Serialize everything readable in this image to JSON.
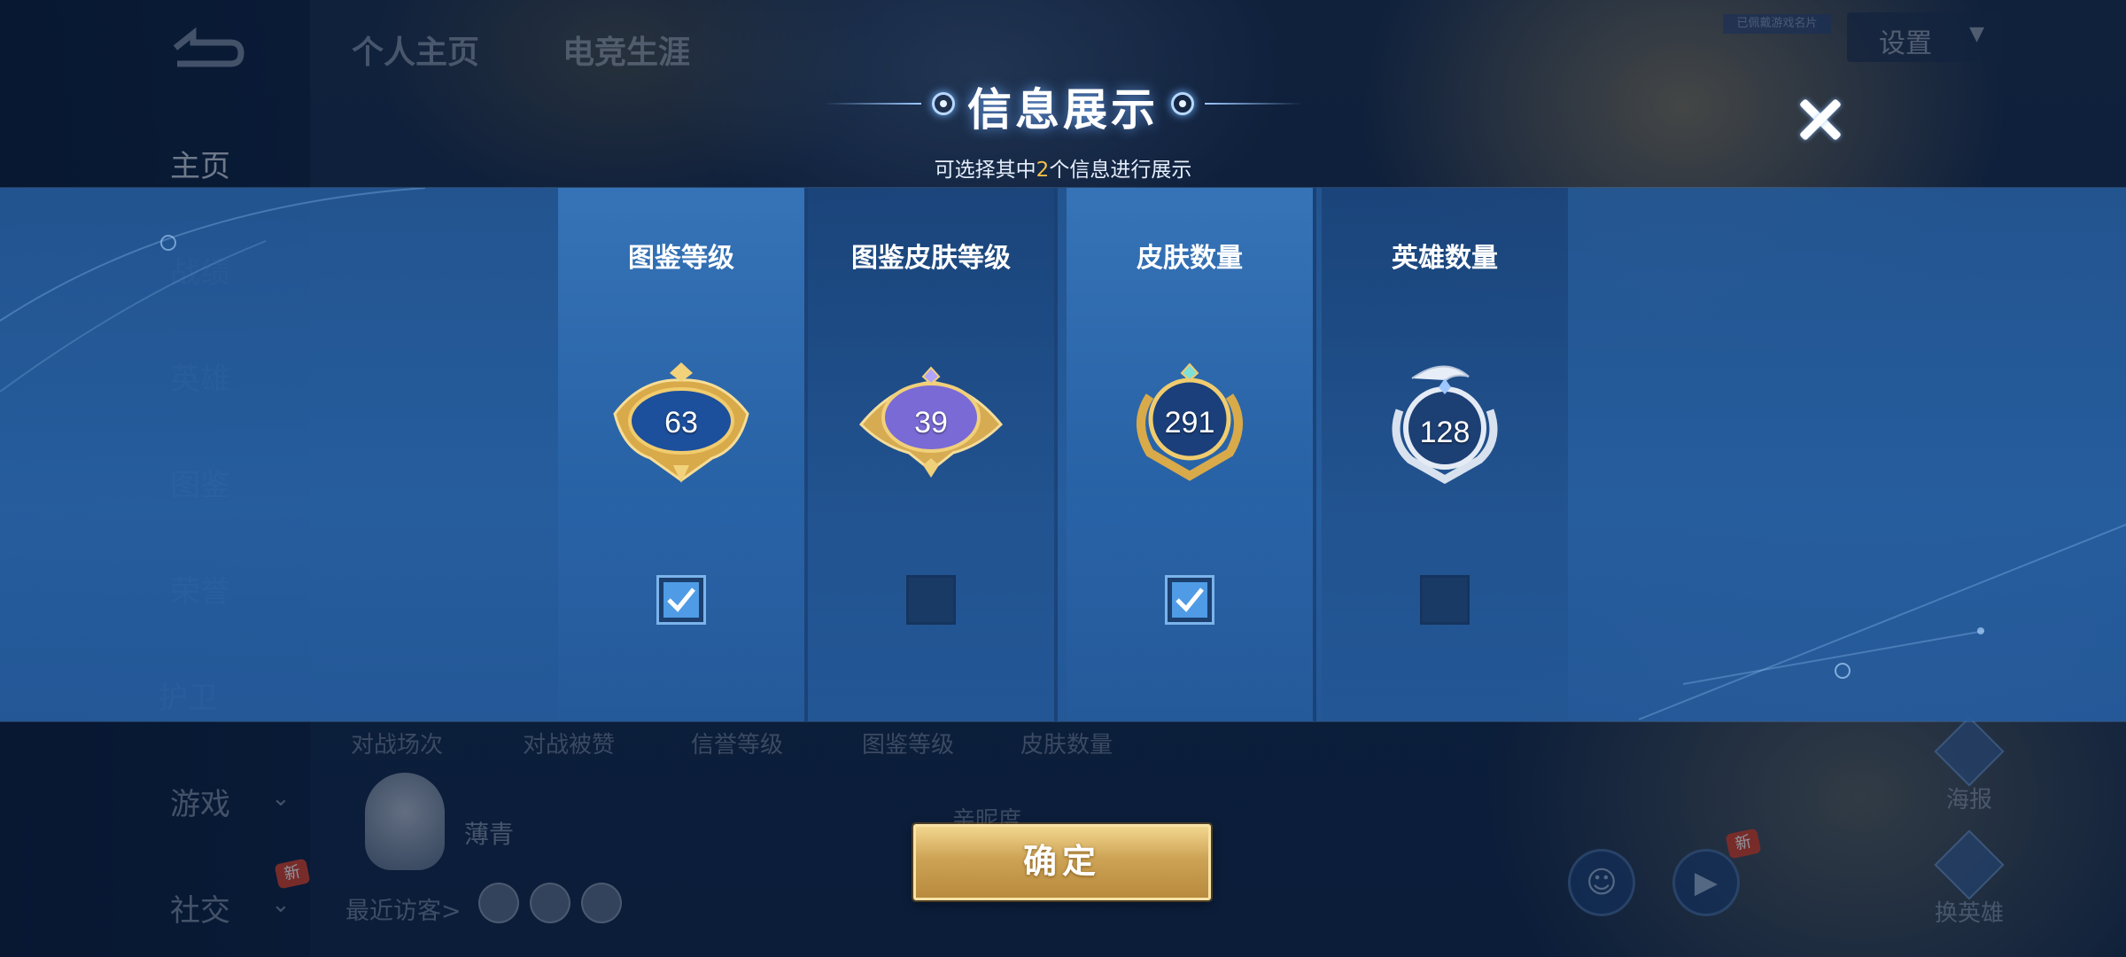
{
  "background": {
    "nav": {
      "items": [
        "主页",
        "战绩",
        "英雄",
        "图鉴",
        "荣誉",
        "护卫"
      ],
      "game": "游戏",
      "social": "社交",
      "new_badge": "新"
    },
    "tabs": [
      "个人主页",
      "电竞生涯"
    ],
    "settings_label": "设置",
    "small_tag": "已佩戴游戏名片",
    "stats_labels": [
      "对战场次",
      "对战被赞",
      "信誉等级",
      "图鉴等级",
      "皮肤数量"
    ],
    "mascot_name": "薄青",
    "intimacy_label": "亲昵度",
    "recent_visitors_label": "最近访客>",
    "side_buttons": [
      "海报",
      "换英雄"
    ]
  },
  "modal": {
    "title": "信息展示",
    "subtitle_prefix": "可选择其中",
    "subtitle_count": "2",
    "subtitle_suffix": "个信息进行展示",
    "confirm_label": "确定",
    "options": [
      {
        "title": "图鉴等级",
        "value": "63",
        "checked": true,
        "badge": "gold-blue-winged"
      },
      {
        "title": "图鉴皮肤等级",
        "value": "39",
        "checked": false,
        "badge": "gold-purple-winged"
      },
      {
        "title": "皮肤数量",
        "value": "291",
        "checked": true,
        "badge": "gold-round-laurel"
      },
      {
        "title": "英雄数量",
        "value": "128",
        "checked": false,
        "badge": "silver-round"
      }
    ]
  },
  "colors": {
    "accent_gold": "#f4c04a",
    "panel_blue": "#2a62a5",
    "checkbox_fill": "#4f9be6",
    "confirm_gold": "#cda355"
  }
}
